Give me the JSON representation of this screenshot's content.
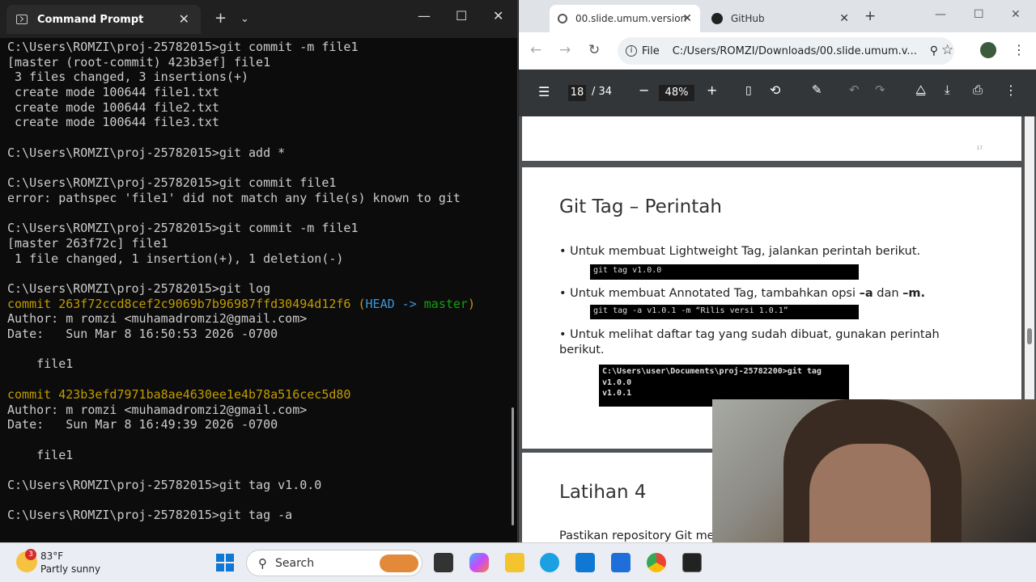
{
  "terminal": {
    "tab_title": "Command Prompt",
    "lines": [
      {
        "t": "C:\\Users\\ROMZI\\proj-25782015>git commit -m file1"
      },
      {
        "t": "[master (root-commit) 423b3ef] file1"
      },
      {
        "t": " 3 files changed, 3 insertions(+)"
      },
      {
        "t": " create mode 100644 file1.txt"
      },
      {
        "t": " create mode 100644 file2.txt"
      },
      {
        "t": " create mode 100644 file3.txt"
      },
      {
        "t": ""
      },
      {
        "t": "C:\\Users\\ROMZI\\proj-25782015>git add *"
      },
      {
        "t": ""
      },
      {
        "t": "C:\\Users\\ROMZI\\proj-25782015>git commit file1"
      },
      {
        "t": "error: pathspec 'file1' did not match any file(s) known to git"
      },
      {
        "t": ""
      },
      {
        "t": "C:\\Users\\ROMZI\\proj-25782015>git commit -m file1"
      },
      {
        "t": "[master 263f72c] file1"
      },
      {
        "t": " 1 file changed, 1 insertion(+), 1 deletion(-)"
      },
      {
        "t": ""
      },
      {
        "t": "C:\\Users\\ROMZI\\proj-25782015>git log"
      },
      {
        "t": "commit 263f72ccd8cef2c9069b7b96987ffd30494d12f6",
        "head": "HEAD -> ",
        "branch": "master"
      },
      {
        "t": "Author: m romzi <muhamadromzi2@gmail.com>"
      },
      {
        "t": "Date:   Sun Mar 8 16:50:53 2026 -0700"
      },
      {
        "t": ""
      },
      {
        "t": "    file1"
      },
      {
        "t": ""
      },
      {
        "t": "commit 423b3efd7971ba8ae4630ee1e4b78a516cec5d80",
        "commit": true
      },
      {
        "t": "Author: m romzi <muhamadromzi2@gmail.com>"
      },
      {
        "t": "Date:   Sun Mar 8 16:49:39 2026 -0700"
      },
      {
        "t": ""
      },
      {
        "t": "    file1"
      },
      {
        "t": ""
      },
      {
        "t": "C:\\Users\\ROMZI\\proj-25782015>git tag v1.0.0"
      },
      {
        "t": ""
      },
      {
        "t": "C:\\Users\\ROMZI\\proj-25782015>git tag -a"
      }
    ]
  },
  "browser": {
    "tabs": [
      {
        "label": "00.slide.umum.version",
        "active": true
      },
      {
        "label": "GitHub",
        "active": false
      }
    ],
    "address": {
      "scheme": "File",
      "url": "C:/Users/ROMZI/Downloads/00.slide.umum.v..."
    },
    "pdf": {
      "page": "18",
      "total": "/ 34",
      "zoom": "48%"
    },
    "page_number_small": "17",
    "slide": {
      "title": "Git Tag – Perintah",
      "b1": "Untuk membuat Lightweight Tag, jalankan perintah berikut.",
      "code1": "git tag v1.0.0",
      "b2_pre": "Untuk membuat Annotated Tag, tambahkan opsi ",
      "b2_a": "–a",
      "b2_mid": " dan ",
      "b2_m": "–m.",
      "code2": "git tag -a v1.0.1 -m “Rilis versi 1.0.1”",
      "b3": "Untuk melihat daftar tag yang sudah dibuat, gunakan perintah berikut.",
      "code3_l1": "C:\\Users\\user\\Documents\\proj-25782200>git tag",
      "code3_l2": "v1.0.0",
      "code3_l3": "v1.0.1"
    },
    "slide2": {
      "title": "Latihan 4",
      "text": "Pastikan repository Git me"
    }
  },
  "taskbar": {
    "weather_badge": "3",
    "temp": "83°F",
    "condition": "Partly sunny",
    "search": "Search"
  }
}
